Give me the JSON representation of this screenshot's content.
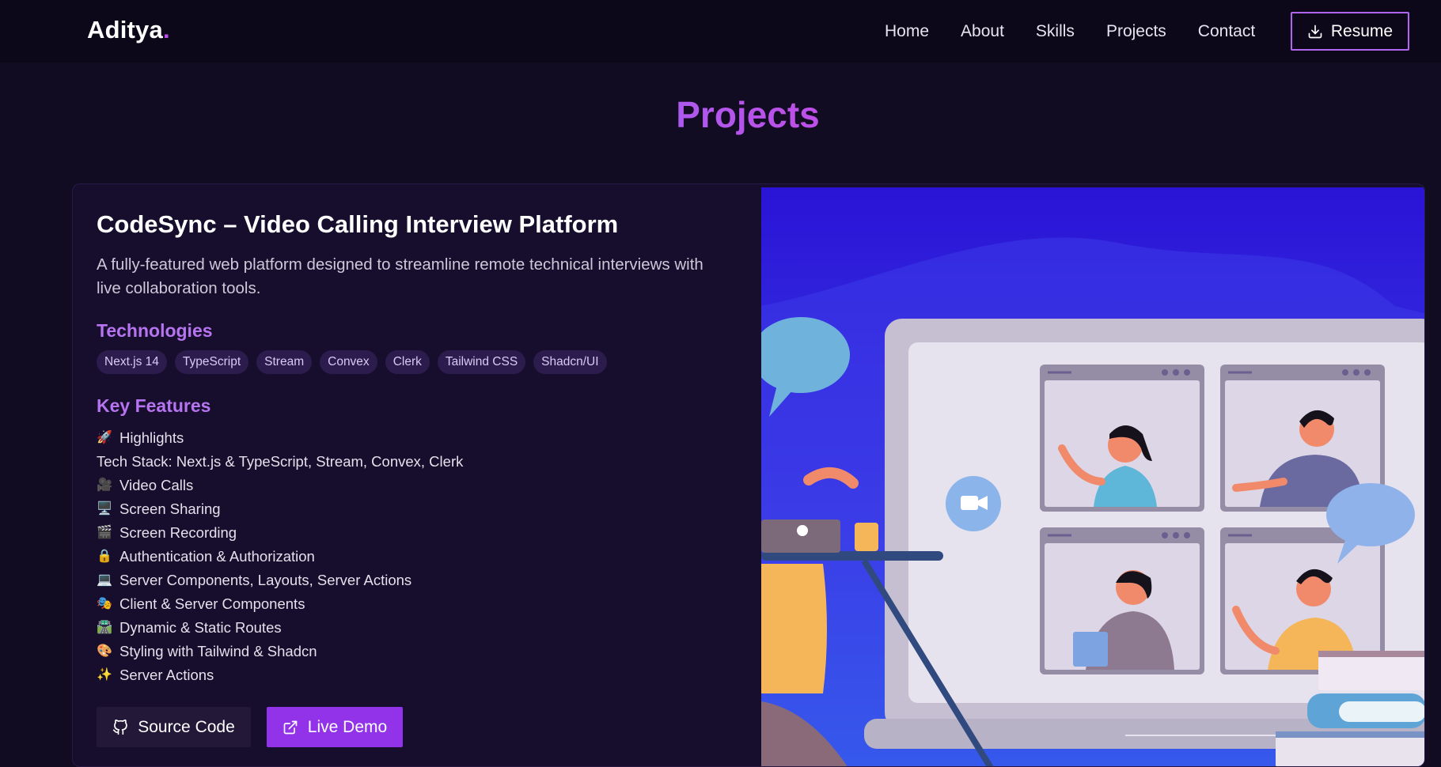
{
  "nav": {
    "brand": "Aditya",
    "brand_dot": ".",
    "links": [
      "Home",
      "About",
      "Skills",
      "Projects",
      "Contact"
    ],
    "resume_label": "Resume",
    "resume_icon": "download-icon"
  },
  "section": {
    "title": "Projects"
  },
  "project": {
    "title": "CodeSync – Video Calling Interview Platform",
    "description": "A fully-featured web platform designed to streamline remote technical interviews with live collaboration tools.",
    "technologies_heading": "Technologies",
    "technologies": [
      "Next.js 14",
      "TypeScript",
      "Stream",
      "Convex",
      "Clerk",
      "Tailwind CSS",
      "Shadcn/UI"
    ],
    "features_heading": "Key Features",
    "features": [
      {
        "icon": "🚀",
        "text": "Highlights"
      },
      {
        "icon": "",
        "text": "Tech Stack: Next.js & TypeScript, Stream, Convex, Clerk"
      },
      {
        "icon": "🎥",
        "text": "Video Calls"
      },
      {
        "icon": "🖥️",
        "text": "Screen Sharing"
      },
      {
        "icon": "🎬",
        "text": "Screen Recording"
      },
      {
        "icon": "🔒",
        "text": "Authentication & Authorization"
      },
      {
        "icon": "💻",
        "text": "Server Components, Layouts, Server Actions"
      },
      {
        "icon": "🎭",
        "text": "Client & Server Components"
      },
      {
        "icon": "🛣️",
        "text": "Dynamic & Static Routes"
      },
      {
        "icon": "🎨",
        "text": "Styling with Tailwind & Shadcn"
      },
      {
        "icon": "✨",
        "text": "Server Actions"
      }
    ],
    "source_label": "Source Code",
    "source_icon": "github-icon",
    "demo_label": "Live Demo",
    "demo_icon": "external-link-icon"
  },
  "colors": {
    "background": "#120c22",
    "navbar": "#0d0819",
    "accent": "#9233ea",
    "heading_accent": "#b674f0",
    "tag_bg": "#2c1c4d"
  }
}
